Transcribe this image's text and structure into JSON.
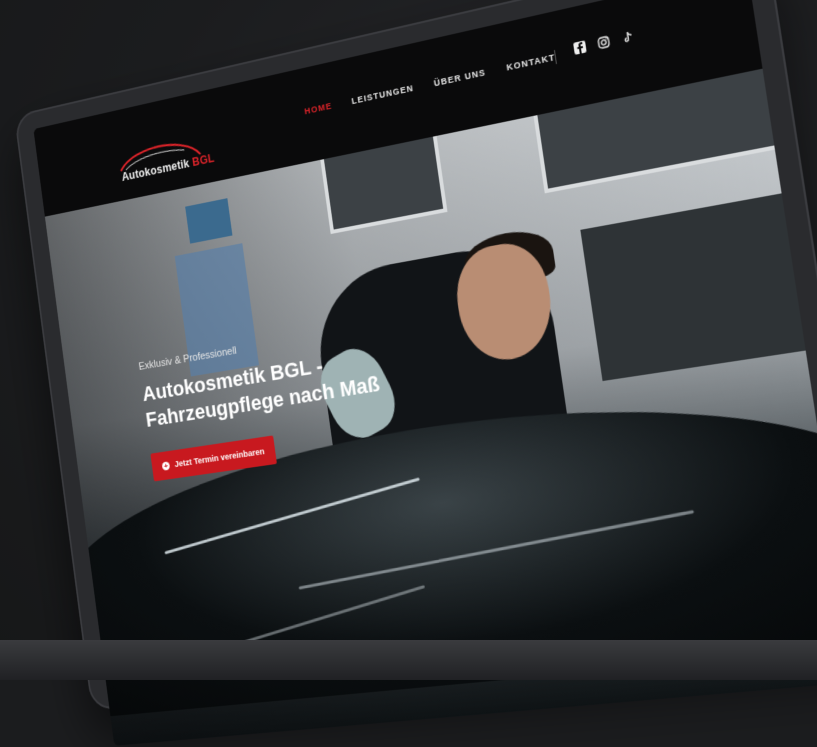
{
  "nav": {
    "logo_main": "Autokosmetik",
    "logo_accent": "BGL",
    "items": [
      {
        "label": "HOME",
        "active": true
      },
      {
        "label": "LEISTUNGEN",
        "active": false
      },
      {
        "label": "ÜBER UNS",
        "active": false
      },
      {
        "label": "KONTAKT",
        "active": false
      }
    ],
    "social_icons": [
      "facebook-icon",
      "instagram-icon",
      "tiktok-icon"
    ]
  },
  "hero": {
    "tagline": "Exklusiv & Professionell",
    "headline": "Autokosmetik BGL - Fahrzeugpflege nach Maß",
    "cta_label": "Jetzt Termin vereinbaren",
    "cta_icon": "plus-circle-icon"
  },
  "colors": {
    "accent": "#c8191f",
    "nav_bg": "#0a0a0b",
    "background": "#1b1c1e"
  }
}
